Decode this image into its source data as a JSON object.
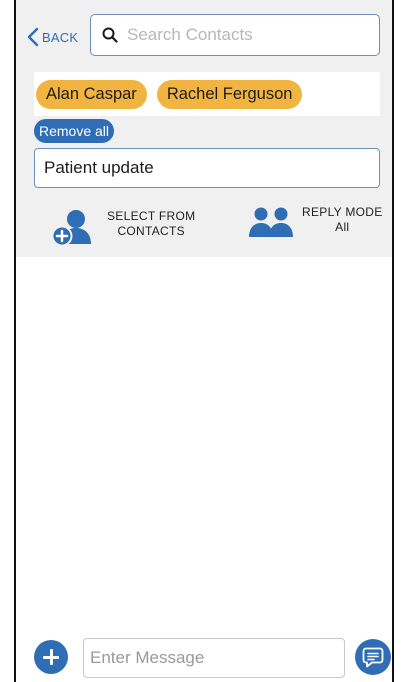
{
  "header": {
    "back_label": "BACK",
    "search_placeholder": "Search Contacts",
    "search_value": ""
  },
  "recipients": [
    "Alan Caspar",
    "Rachel Ferguson"
  ],
  "remove_all_label": "Remove all",
  "subject": {
    "value": "Patient update"
  },
  "options": {
    "select_from_contacts": {
      "line1": "SELECT FROM",
      "line2": "CONTACTS",
      "icon": "add-contact-icon"
    },
    "reply_mode": {
      "line1": "REPLY MODE",
      "line2": "All",
      "icon": "group-icon"
    }
  },
  "composer": {
    "placeholder": "Enter Message",
    "value": "",
    "add_icon": "plus-icon",
    "send_icon": "chat-bubble-icon"
  },
  "colors": {
    "accent": "#2f6db5",
    "chip": "#f2b441",
    "panel": "#f0f0f0"
  }
}
